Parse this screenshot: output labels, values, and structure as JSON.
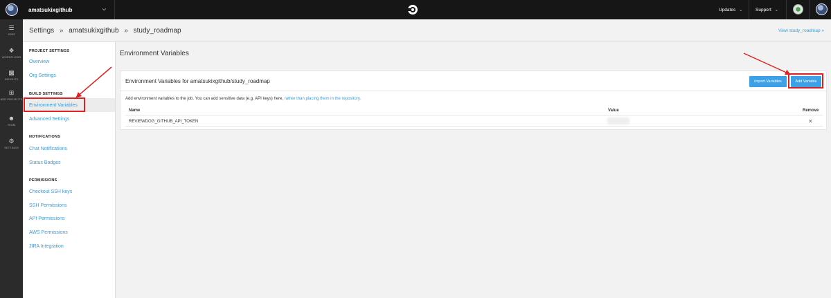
{
  "topbar": {
    "org_name": "amatsukixgithub",
    "updates_label": "Updates",
    "support_label": "Support"
  },
  "rail": {
    "items": [
      {
        "label": "JOBS",
        "icon": "list-icon"
      },
      {
        "label": "WORKFLOWS",
        "icon": "workflow-icon"
      },
      {
        "label": "INSIGHTS",
        "icon": "bar-chart-icon"
      },
      {
        "label": "ADD PROJECTS",
        "icon": "add-project-icon"
      },
      {
        "label": "TEAM",
        "icon": "team-icon"
      },
      {
        "label": "SETTINGS",
        "icon": "gear-icon"
      }
    ]
  },
  "header": {
    "crumb_settings": "Settings",
    "crumb_sep": "»",
    "crumb_org": "amatsukixgithub",
    "crumb_project": "study_roadmap",
    "view_link": "View study_roadmap »"
  },
  "sidebar": {
    "project_settings": "PROJECT SETTINGS",
    "overview": "Overview",
    "org_settings": "Org Settings",
    "build_settings": "BUILD SETTINGS",
    "env_vars": "Environment Variables",
    "advanced": "Advanced Settings",
    "notifications": "NOTIFICATIONS",
    "chat": "Chat Notifications",
    "badges": "Status Badges",
    "permissions": "PERMISSIONS",
    "ssh_keys": "Checkout SSH keys",
    "ssh_perms": "SSH Permissions",
    "api_perms": "API Permissions",
    "aws_perms": "AWS Permissions",
    "jira": "JIRA Integration"
  },
  "main": {
    "title": "Environment Variables",
    "card_title": "Environment Variables for amatsukixgithub/study_roadmap",
    "import_button": "Import Variables",
    "add_button": "Add Variable",
    "desc_text": "Add environment variables to the job. You can add sensitive data (e.g. API keys) here,",
    "desc_link": "rather than placing them in the repository.",
    "col_name": "Name",
    "col_value": "Value",
    "col_remove": "Remove",
    "rows": [
      {
        "name": "REVIEWDOG_GITHUB_API_TOKEN"
      }
    ]
  },
  "colors": {
    "accent": "#3ca1e6",
    "link": "#3b9ad9",
    "annotation": "#e02020"
  }
}
